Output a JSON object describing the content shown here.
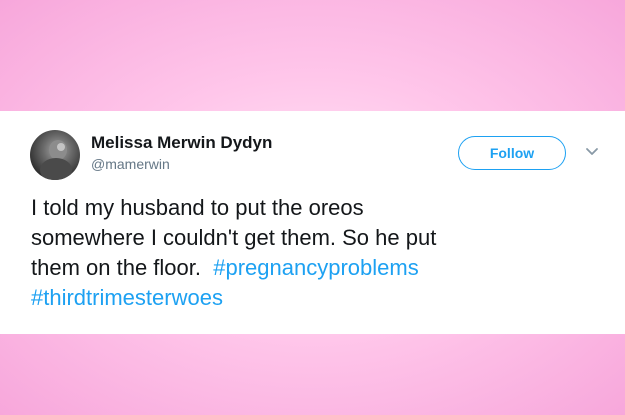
{
  "tweet": {
    "author": {
      "name": "Melissa Merwin Dydyn",
      "handle": "@mamerwin"
    },
    "follow_label": "Follow",
    "text_lines": [
      {
        "text": "I told my husband to put the oreos",
        "hashtag": ""
      },
      {
        "text": "somewhere I couldn't get them.  So he put",
        "hashtag": ""
      },
      {
        "text": "them on the floor.  ",
        "hashtag": "#pregnancyproblems"
      },
      {
        "text": "",
        "hashtag": "#thirdtrimesterwoes"
      }
    ]
  },
  "icons": {
    "avatar": "avatar-photo",
    "menu": "chevron-down-icon"
  },
  "colors": {
    "accent": "#1da1f2",
    "text": "#14171a",
    "secondary_text": "#657786",
    "background_pink": "#ffc6ea",
    "card": "#ffffff"
  }
}
